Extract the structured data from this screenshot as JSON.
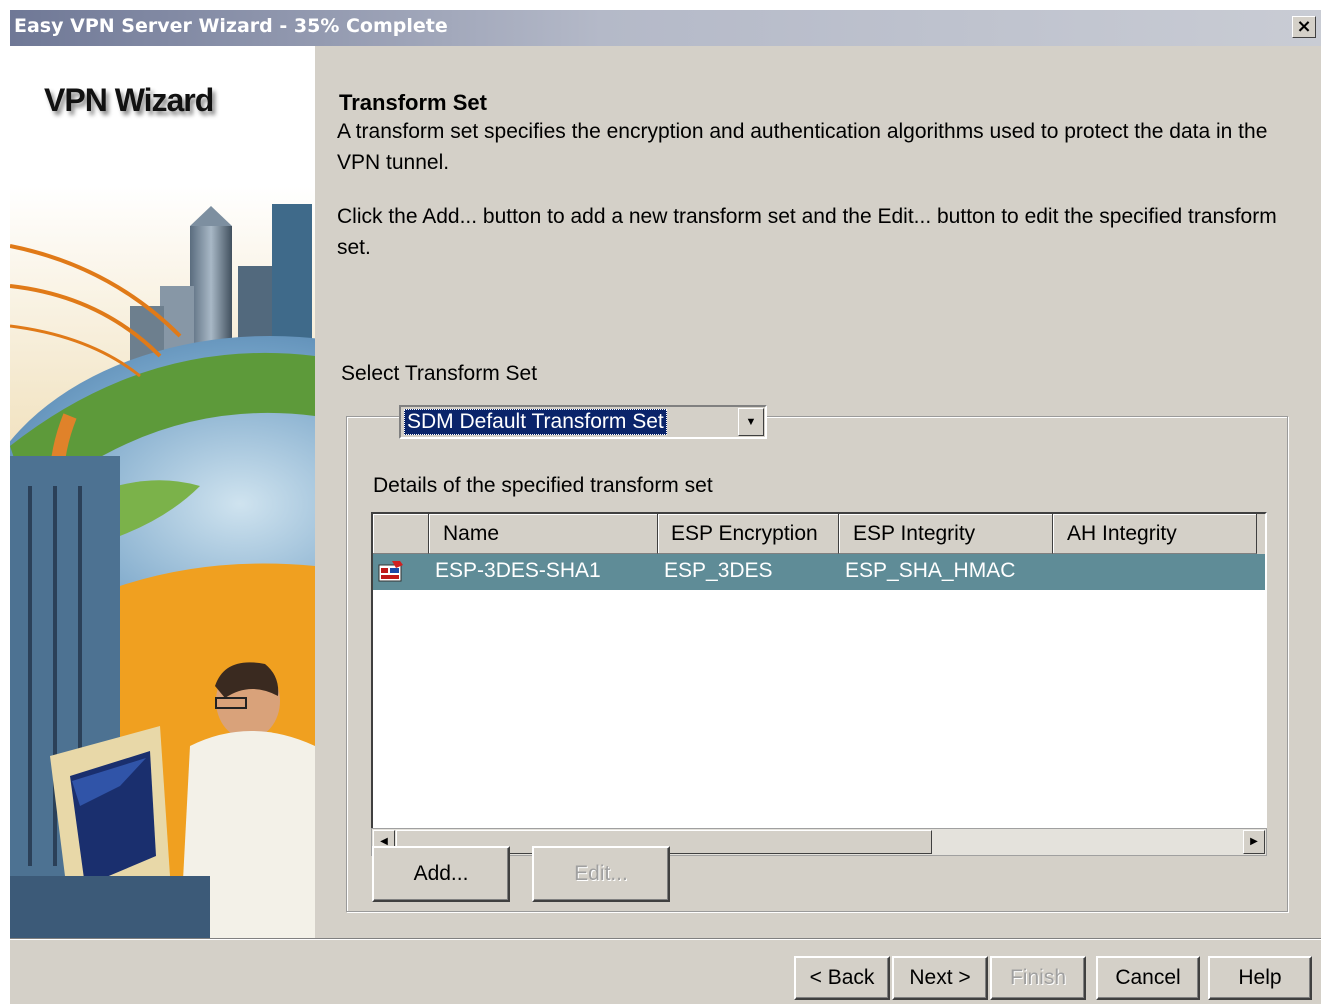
{
  "window": {
    "title": "Easy VPN Server Wizard - 35% Complete",
    "close_glyph": "×",
    "progress_percent": 35
  },
  "side_panel": {
    "title": "VPN Wizard"
  },
  "content": {
    "section_title": "Transform Set",
    "description": "A transform set specifies the encryption and authentication algorithms used to protect the data in the VPN tunnel.",
    "instructions": "Click the Add... button to add a new transform set and the Edit... button to edit the specified transform set.",
    "select_label": "Select Transform Set",
    "select_value": "SDM Default Transform Set",
    "details_label": "Details of the specified transform set"
  },
  "table": {
    "columns": [
      "",
      "Name",
      "ESP Encryption",
      "ESP Integrity",
      "AH Integrity"
    ],
    "rows": [
      {
        "icon": "transform-set-icon",
        "name": "ESP-3DES-SHA1",
        "esp_encryption": "ESP_3DES",
        "esp_integrity": "ESP_SHA_HMAC",
        "ah_integrity": ""
      }
    ]
  },
  "buttons": {
    "add": "Add...",
    "edit": "Edit..."
  },
  "nav": {
    "back": "< Back",
    "next": "Next >",
    "finish": "Finish",
    "cancel": "Cancel",
    "help": "Help"
  },
  "colors": {
    "selection": "#0a246a",
    "selected_row": "#5f8c97",
    "window_face": "#d4d0c8"
  }
}
